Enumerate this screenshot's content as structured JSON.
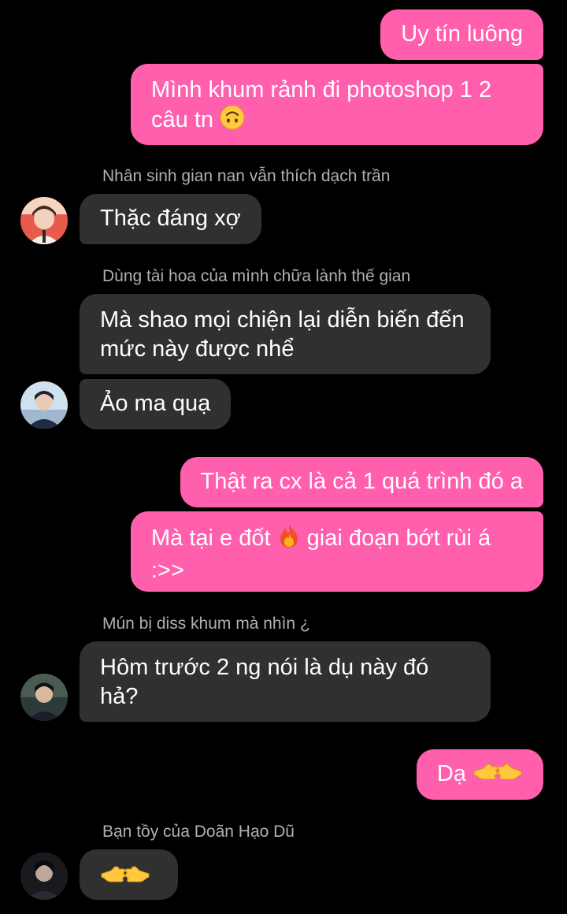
{
  "colors": {
    "background": "#000000",
    "outgoing_bubble": "#ff5fad",
    "incoming_bubble": "#303030",
    "sender_name": "#b0b0b0"
  },
  "messages": [
    {
      "direction": "outgoing",
      "text": "Uy tín luông"
    },
    {
      "direction": "outgoing",
      "text": "Mình khum rảnh đi photoshop 1 2 câu tn",
      "emoji": "upside-down-face-icon"
    },
    {
      "direction": "incoming",
      "sender": "Nhân sinh gian nan vẫn thích dạch trần",
      "text": "Thặc đáng xợ"
    },
    {
      "direction": "incoming",
      "sender": "Dùng tài hoa của mình chữa lành thế gian",
      "text": "Mà shao mọi chiện lại diễn biến đến mức này được nhể"
    },
    {
      "direction": "incoming",
      "text": "Ảo ma quạ"
    },
    {
      "direction": "outgoing",
      "text": "Thật ra cx là cả 1 quá trình đó a"
    },
    {
      "direction": "outgoing",
      "text_before": "Mà tại e đốt",
      "emoji": "fire-icon",
      "text_after": "giai đoạn bớt rùi á :>>"
    },
    {
      "direction": "incoming",
      "sender": "Mún bị diss khum mà nhìn ¿",
      "text": "Hôm trước 2 ng nói là dụ này đó hả?"
    },
    {
      "direction": "outgoing",
      "text": "Dạ",
      "emoji": "pointing-hands-icon"
    },
    {
      "direction": "incoming",
      "sender": "Bạn tồy của Doãn Hạo Dũ",
      "emoji": "pointing-hands-icon"
    }
  ]
}
